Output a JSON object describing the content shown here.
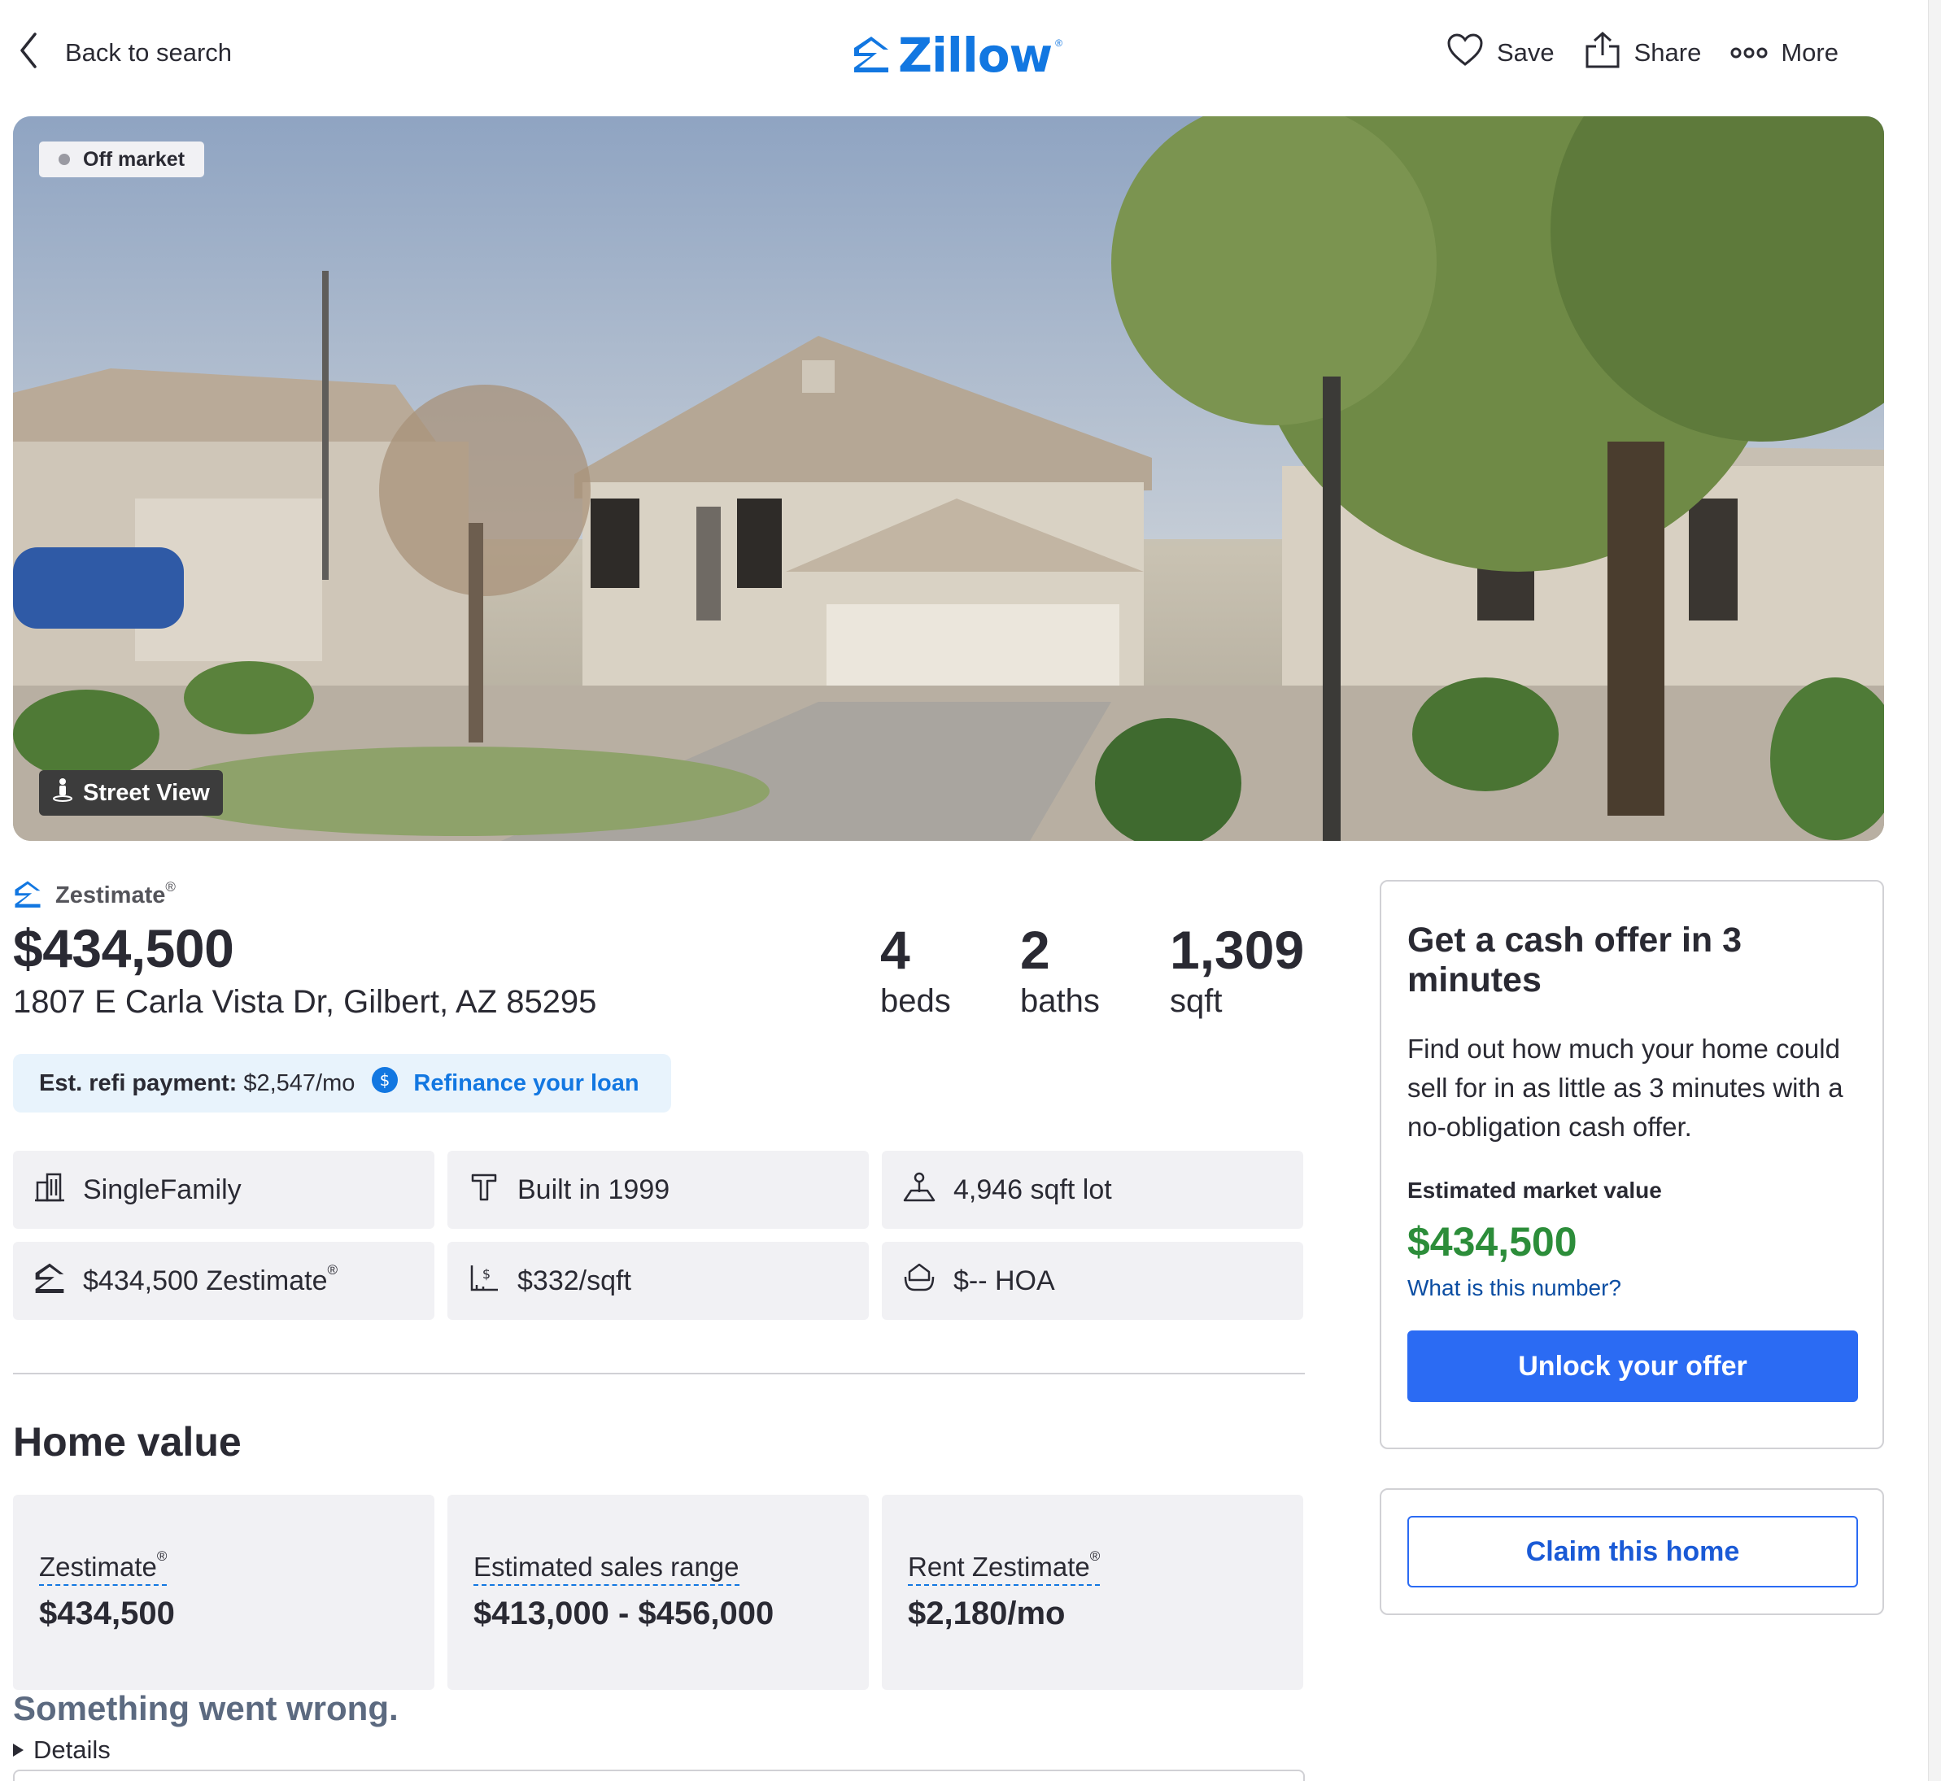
{
  "header": {
    "back_label": "Back to search",
    "logo_text": "Zillow",
    "logo_mark": "®",
    "actions": [
      {
        "label": "Save",
        "icon": "heart-icon"
      },
      {
        "label": "Share",
        "icon": "share-icon"
      },
      {
        "label": "More",
        "icon": "more-dots-icon"
      }
    ]
  },
  "hero": {
    "status_badge": "Off market",
    "street_view_label": "Street View"
  },
  "summary": {
    "zestimate_label": "Zestimate",
    "registered_mark": "®",
    "price": "$434,500",
    "address": "1807 E Carla Vista Dr, Gilbert, AZ 85295",
    "beds_value": "4",
    "beds_label": "beds",
    "baths_value": "2",
    "baths_label": "baths",
    "sqft_value": "1,309",
    "sqft_label": "sqft"
  },
  "refi": {
    "label": "Est. refi payment:",
    "value": "$2,547/mo",
    "link": "Refinance your loan"
  },
  "facts": [
    {
      "icon": "building-icon",
      "text": "SingleFamily"
    },
    {
      "icon": "hammer-icon",
      "text": "Built in 1999"
    },
    {
      "icon": "lot-icon",
      "text": "4,946 sqft lot"
    },
    {
      "icon": "zestimate-logo-icon",
      "text": "$434,500 Zestimate"
    },
    {
      "icon": "price-per-sqft-icon",
      "text": "$332/sqft"
    },
    {
      "icon": "hoa-icon",
      "text": "$-- HOA"
    }
  ],
  "home_value": {
    "title": "Home value",
    "cards": [
      {
        "label": "Zestimate",
        "value": "$434,500"
      },
      {
        "label": "Estimated sales range",
        "value": "$413,000 - $456,000"
      },
      {
        "label": "Rent Zestimate",
        "value": "$2,180/mo"
      }
    ]
  },
  "error": {
    "message": "Something went wrong.",
    "details_label": "Details"
  },
  "cash_offer": {
    "title": "Get a cash offer in 3 minutes",
    "body": "Find out how much your home could sell for in as little as 3 minutes with a no-obligation cash offer.",
    "estimated_label": "Estimated market value",
    "estimated_value": "$434,500",
    "what_link": "What is this number?",
    "button": "Unlock your offer"
  },
  "claim": {
    "button": "Claim this home"
  },
  "colors": {
    "brand_blue": "#1277e1",
    "button_blue": "#2b6bf3",
    "value_green": "#2c8d3a"
  }
}
